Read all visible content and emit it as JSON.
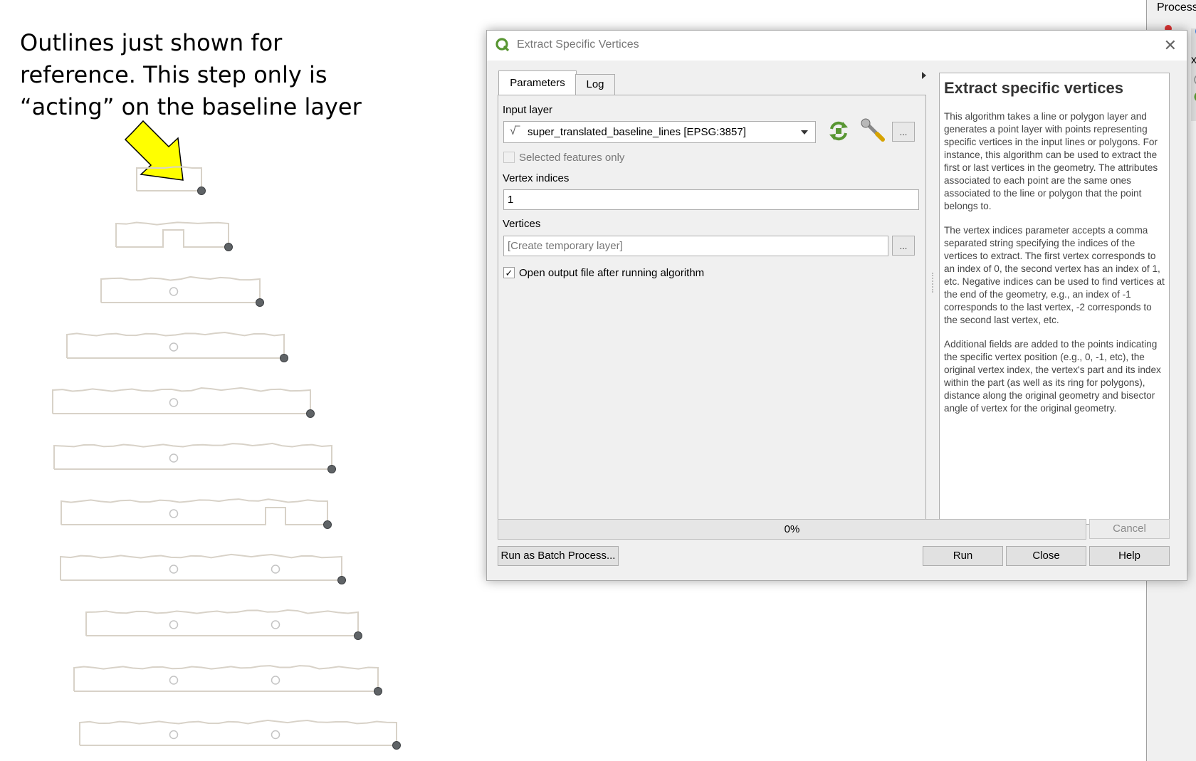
{
  "annotation": {
    "lines": [
      "Outlines just shown for",
      "reference. This step only is",
      "“acting” on the baseline layer"
    ],
    "arrow_color": "#ffff00"
  },
  "side_panel": {
    "title": "Process",
    "fragment": "xt"
  },
  "dialog": {
    "title": "Extract Specific Vertices",
    "tabs": [
      "Parameters",
      "Log"
    ],
    "input_layer_label": "Input layer",
    "input_layer_value": "super_translated_baseline_lines [EPSG:3857]",
    "selected_features_label": "Selected features only",
    "selected_features_checked": false,
    "vertex_indices_label": "Vertex indices",
    "vertex_indices_value": "1",
    "vertices_label": "Vertices",
    "vertices_placeholder": "[Create temporary layer]",
    "open_output_label": "Open output file after running algorithm",
    "open_output_checked": true,
    "browse_label": "...",
    "progress_text": "0%",
    "progress_value": 0,
    "buttons": {
      "cancel": "Cancel",
      "batch": "Run as Batch Process...",
      "run": "Run",
      "close": "Close",
      "help": "Help"
    },
    "help": {
      "heading": "Extract specific vertices",
      "paragraphs": [
        "This algorithm takes a line or polygon layer and generates a point layer with points representing specific vertices in the input lines or polygons. For instance, this algorithm can be used to extract the first or last vertices in the geometry. The attributes associated to each point are the same ones associated to the line or polygon that the point belongs to.",
        "The vertex indices parameter accepts a comma separated string specifying the indices of the vertices to extract. The first vertex corresponds to an index of 0, the second vertex has an index of 1, etc. Negative indices can be used to find vertices at the end of the geometry, e.g., an index of -1 corresponds to the last vertex, -2 corresponds to the second last vertex, etc.",
        "Additional fields are added to the points indicating the specific vertex position (e.g., 0, -1, etc), the original vertex index, the vertex's part and its index within the part (as well as its ring for polygons), distance along the original geometry and bisector angle of vertex for the original geometry."
      ]
    }
  },
  "colors": {
    "outline": "#d8d2c8",
    "vertex": "#5f6366",
    "qgis_green": "#589632"
  }
}
